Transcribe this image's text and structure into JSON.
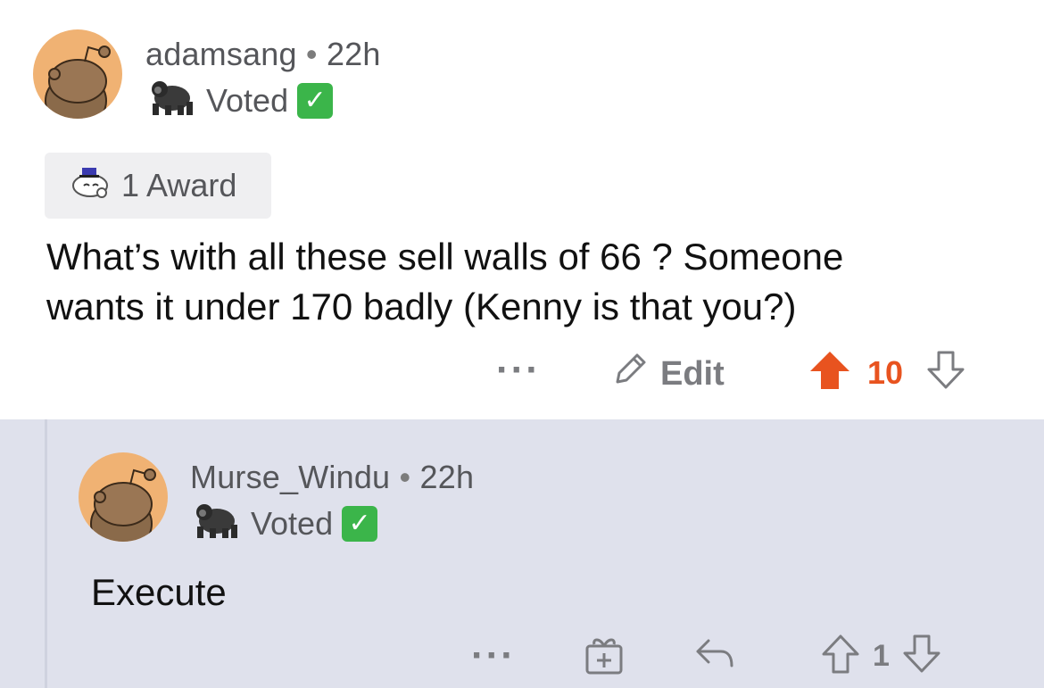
{
  "comment": {
    "username": "adamsang",
    "separator": "•",
    "time": "22h",
    "flair_text": "Voted",
    "flair_check": "✓",
    "award_label": "1 Award",
    "body_line1": "What’s with all these sell walls of 66 ? Someone",
    "body_line2": "wants it under 170 badly (Kenny is that you?)",
    "more_label": "···",
    "edit_label": "Edit",
    "score": "10",
    "upvote_color": "#e8531f"
  },
  "reply": {
    "username": "Murse_Windu",
    "separator": "•",
    "time": "22h",
    "flair_text": "Voted",
    "flair_check": "✓",
    "body": "Execute",
    "more_label": "···",
    "score": "1"
  },
  "icons": {
    "avatar": "snoo-avatar",
    "flair_emoji": "gorilla-icon",
    "award": "award-icon",
    "edit": "pencil-icon",
    "upvote": "upvote-arrow-icon",
    "downvote": "downvote-arrow-icon",
    "gift": "gift-icon",
    "reply": "reply-icon"
  },
  "colors": {
    "reply_background": "#dfe1ec",
    "check_green": "#3bb54a",
    "avatar_bg": "#f0b273"
  }
}
